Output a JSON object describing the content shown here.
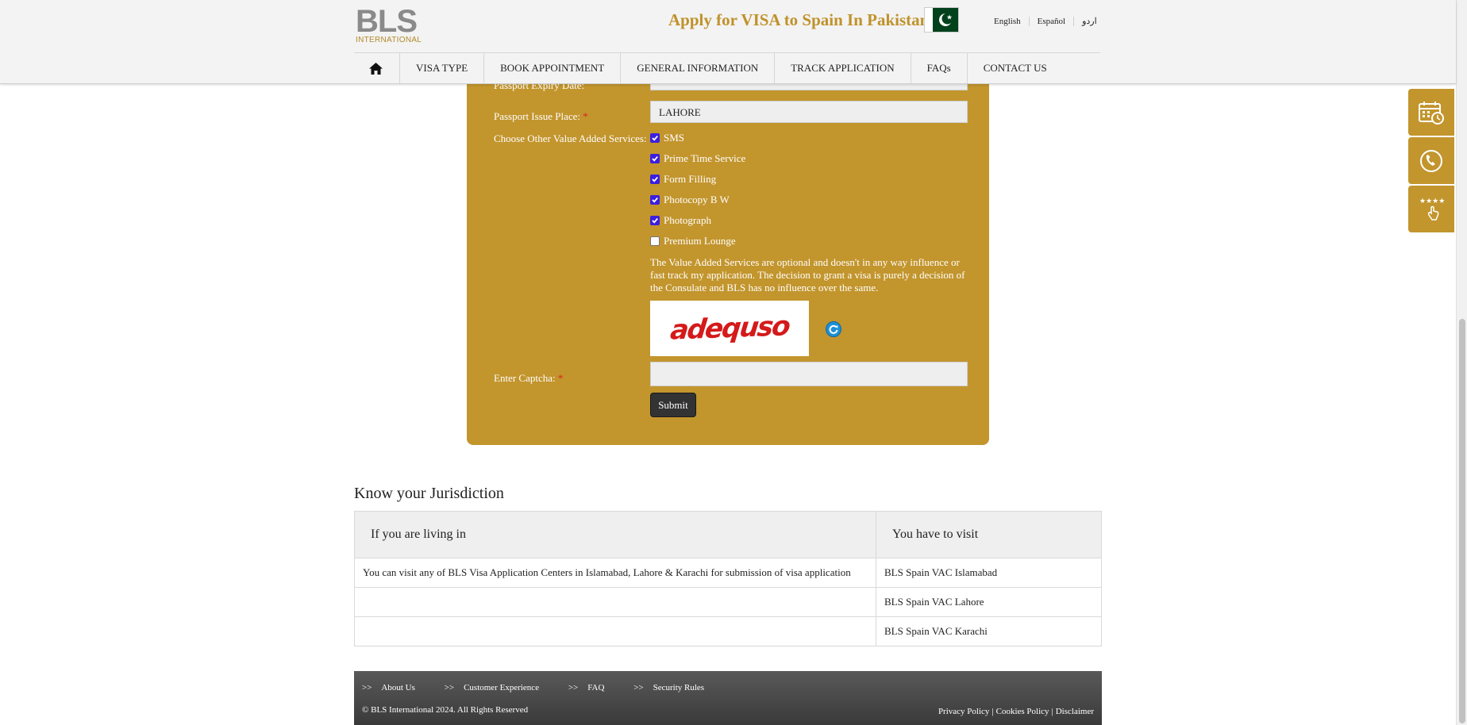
{
  "header": {
    "logo_main": "BLS",
    "logo_sub": "INTERNATIONAL",
    "title": "Apply for VISA to Spain In Pakistan",
    "flag_icon": "pakistan-flag-icon",
    "languages": [
      "English",
      "Español",
      "اردو"
    ]
  },
  "nav": {
    "home_icon": "home-icon",
    "items": [
      "VISA TYPE",
      "BOOK APPOINTMENT",
      "GENERAL INFORMATION",
      "TRACK APPLICATION",
      "FAQs",
      "CONTACT US"
    ]
  },
  "form": {
    "passport_expiry_label": "Passport Expiry Date:",
    "passport_issue_place_label": "Passport Issue Place:",
    "passport_issue_place_value": "LAHORE",
    "required_mark": "*",
    "vas_label": "Choose Other Value Added Services:",
    "services": [
      {
        "label": "SMS",
        "checked": true
      },
      {
        "label": "Prime Time Service",
        "checked": true
      },
      {
        "label": "Form Filling",
        "checked": true
      },
      {
        "label": "Photocopy B W",
        "checked": true
      },
      {
        "label": "Photograph",
        "checked": true
      },
      {
        "label": "Premium Lounge",
        "checked": false
      }
    ],
    "note": "The Value Added Services are optional and doesn't in any way influence or fast track my application. The decision to grant a visa is purely a decision of the Consulate and BLS has no influence over the same.",
    "captcha_text": "adequso",
    "captcha_label": "Enter Captcha:",
    "captcha_value": "",
    "submit_label": "Submit"
  },
  "jurisdiction": {
    "title": "Know your Jurisdiction",
    "col1_header": "If you are living in",
    "col2_header": "You have to visit",
    "rows": [
      {
        "living": "You can visit any of BLS Visa Application Centers in Islamabad, Lahore & Karachi for submission of visa application",
        "visit": "BLS Spain VAC Islamabad"
      },
      {
        "living": "",
        "visit": "BLS Spain VAC Lahore"
      },
      {
        "living": "",
        "visit": "BLS Spain VAC Karachi"
      }
    ]
  },
  "footer": {
    "arrow": ">>",
    "links": [
      "About Us",
      "Customer Experience",
      "FAQ",
      "Security Rules"
    ],
    "copyright": "© BLS International 2024. All Rights Reserved",
    "legal": [
      "Privacy Policy",
      "Cookies Policy",
      "Disclaimer"
    ],
    "legal_sep": "|"
  },
  "side_buttons": [
    "calendar-clock-icon",
    "phone-icon",
    "rating-feedback-icon"
  ],
  "colors": {
    "accent": "#c2952d",
    "header_bg": "#f3f3f3",
    "footer_dark": "#3a3a3a",
    "checkbox": "#3b1fe0"
  }
}
